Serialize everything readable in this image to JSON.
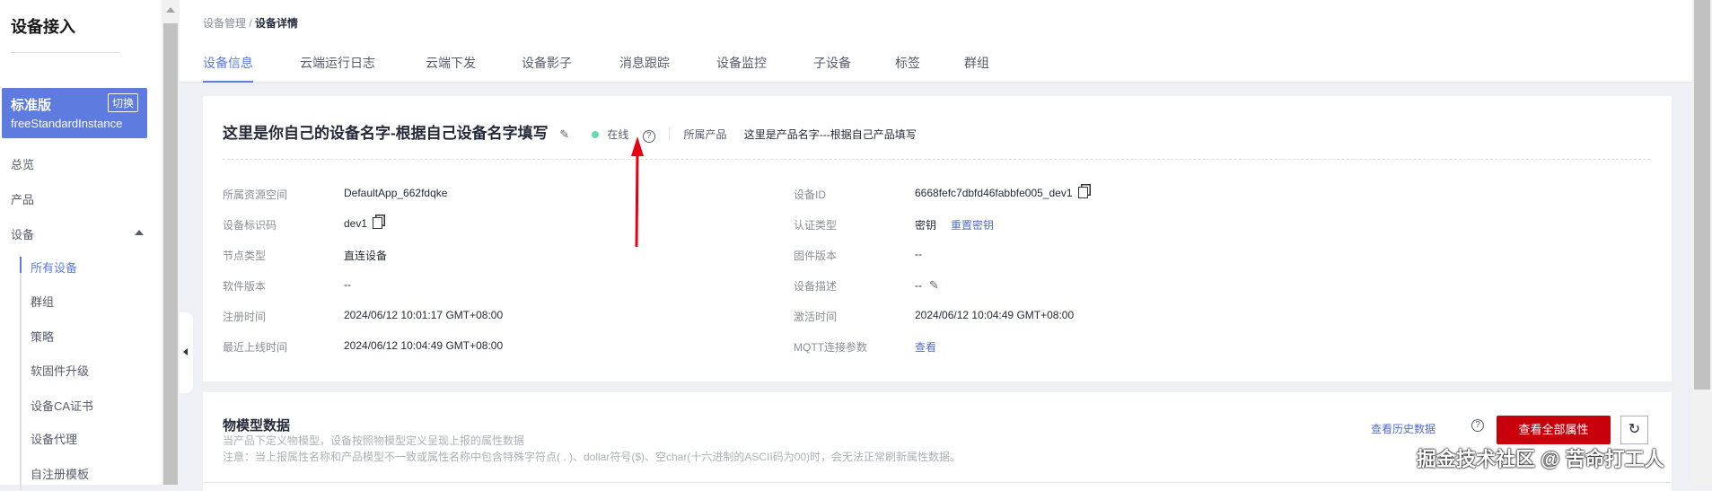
{
  "sidebar": {
    "title": "设备接入",
    "instance": {
      "name": "标准版",
      "switch": "切换",
      "id": "freeStandardInstance"
    },
    "items": [
      "总览",
      "产品",
      "设备"
    ],
    "subitems": [
      "所有设备",
      "群组",
      "策略",
      "软固件升级",
      "设备CA证书",
      "设备代理",
      "自注册模板"
    ]
  },
  "breadcrumb": {
    "parent": "设备管理",
    "sep": " / ",
    "current": "设备详情"
  },
  "tabs": [
    "设备信息",
    "云端运行日志",
    "云端下发",
    "设备影子",
    "消息跟踪",
    "设备监控",
    "子设备",
    "标签",
    "群组"
  ],
  "device": {
    "name": "这里是你自己的设备名字-根据自己设备名字填写",
    "status": "在线",
    "product_label": "所属产品",
    "product": "这里是产品名字---根据自己产品填写",
    "left": [
      {
        "label": "所属资源空间",
        "value": "DefaultApp_662fdqke"
      },
      {
        "label": "设备标识码",
        "value": "dev1"
      },
      {
        "label": "节点类型",
        "value": "直连设备"
      },
      {
        "label": "软件版本",
        "value": "--"
      },
      {
        "label": "注册时间",
        "value": "2024/06/12 10:01:17 GMT+08:00"
      },
      {
        "label": "最近上线时间",
        "value": "2024/06/12 10:04:49 GMT+08:00"
      }
    ],
    "right": [
      {
        "label": "设备ID",
        "value": "6668fefc7dbfd46fabbfe005_dev1"
      },
      {
        "label": "认证类型",
        "value": "密钥",
        "link": "重置密钥"
      },
      {
        "label": "固件版本",
        "value": "--"
      },
      {
        "label": "设备描述",
        "value": "--"
      },
      {
        "label": "激活时间",
        "value": "2024/06/12 10:04:49 GMT+08:00"
      },
      {
        "label": "MQTT连接参数",
        "link": "查看"
      }
    ]
  },
  "model": {
    "title": "物模型数据",
    "subtitle": "当产品下定义物模型，设备按照物模型定义呈现上报的属性数据",
    "note": "注意：当上报属性名称和产品模型不一致或属性名称中包含特殊字符点( . )、dollar符号($)、空char(十六进制的ASCII码为00)时，会无法正常刷新属性数据。",
    "history": "查看历史数据",
    "view_all": "查看全部属性"
  },
  "watermark": "掘金技术社区 @ 苦命打工人",
  "colors": {
    "accent": "#5e7ce0",
    "primary_button": "#c7000b",
    "online": "#6cd8b0",
    "arrow": "#e60012"
  }
}
